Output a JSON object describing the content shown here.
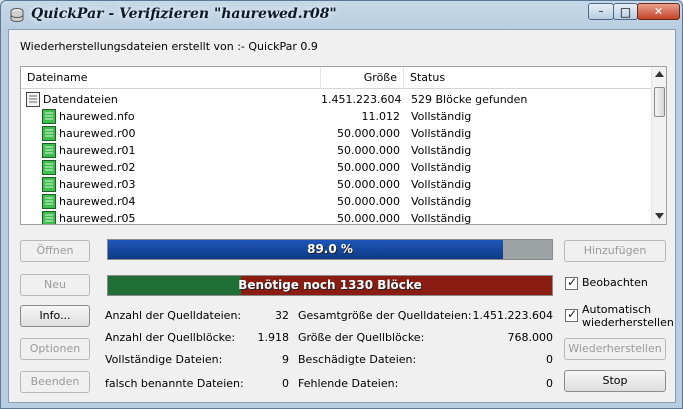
{
  "window": {
    "title": "QuickPar - Verifizieren \"haurewed.r08\"",
    "buttons": {
      "minimize": "–",
      "maximize": "□",
      "close": "✕"
    }
  },
  "created_by": "Wiederherstellungsdateien erstellt von :- QuickPar 0.9",
  "file_list": {
    "columns": {
      "name": "Dateiname",
      "size": "Größe",
      "status": "Status"
    },
    "rows": [
      {
        "name": "Datendateien",
        "size": "1.451.223.604",
        "status": "529 Blöcke gefunden",
        "icon": "data-files-icon"
      },
      {
        "name": "haurewed.nfo",
        "size": "11.012",
        "status": "Vollständig",
        "icon": "green-file-icon"
      },
      {
        "name": "haurewed.r00",
        "size": "50.000.000",
        "status": "Vollständig",
        "icon": "green-file-icon"
      },
      {
        "name": "haurewed.r01",
        "size": "50.000.000",
        "status": "Vollständig",
        "icon": "green-file-icon"
      },
      {
        "name": "haurewed.r02",
        "size": "50.000.000",
        "status": "Vollständig",
        "icon": "green-file-icon"
      },
      {
        "name": "haurewed.r03",
        "size": "50.000.000",
        "status": "Vollständig",
        "icon": "green-file-icon"
      },
      {
        "name": "haurewed.r04",
        "size": "50.000.000",
        "status": "Vollständig",
        "icon": "green-file-icon"
      },
      {
        "name": "haurewed.r05",
        "size": "50.000.000",
        "status": "Vollständig",
        "icon": "green-file-icon"
      }
    ]
  },
  "buttons": {
    "open": "Öffnen",
    "new": "Neu",
    "info": "Info...",
    "options": "Optionen",
    "exit": "Beenden",
    "add": "Hinzufügen",
    "repair": "Wiederherstellen",
    "stop": "Stop"
  },
  "progress": {
    "verify": {
      "text": "89.0 %",
      "fraction": 0.89,
      "color": "#1e56b8"
    },
    "blocks": {
      "text": "Benötige noch 1330 Blöcke",
      "fraction_left": 0.3,
      "green": "#1f6e35",
      "red": "#8a1c12"
    }
  },
  "checkboxes": {
    "watch": {
      "label": "Beobachten",
      "checked": true
    },
    "auto_repair": {
      "label": "Automatisch wiederherstellen",
      "label_line1": "Automatisch",
      "label_line2": "wiederherstellen",
      "checked": true
    }
  },
  "stats": {
    "source_files_label": "Anzahl der Quelldateien:",
    "source_files_value": "32",
    "source_blocks_label": "Anzahl der Quellblöcke:",
    "source_blocks_value": "1.918",
    "complete_files_label": "Vollständige Dateien:",
    "complete_files_value": "9",
    "misnamed_files_label": "falsch benannte Dateien:",
    "misnamed_files_value": "0",
    "total_size_label": "Gesamtgröße der Quelldateien:",
    "total_size_value": "1.451.223.604",
    "block_size_label": "Größe der Quellblöcke:",
    "block_size_value": "768.000",
    "damaged_files_label": "Beschädigte Dateien:",
    "damaged_files_value": "0",
    "missing_files_label": "Fehlende Dateien:",
    "missing_files_value": "0"
  }
}
